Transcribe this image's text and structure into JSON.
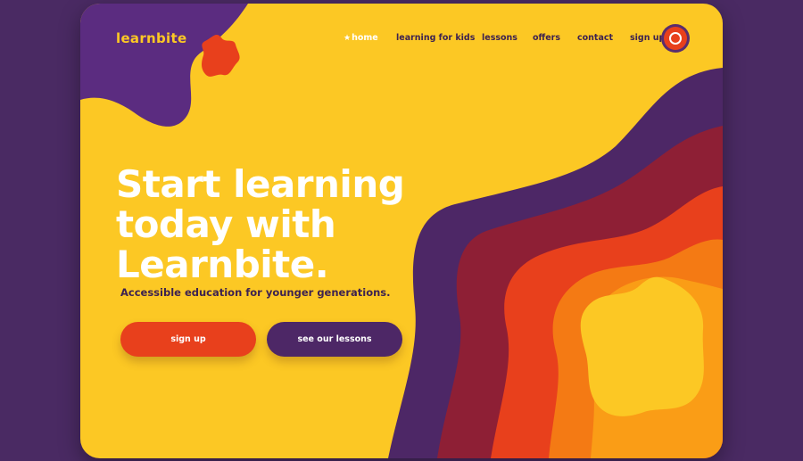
{
  "brand": {
    "logo_text": "learnbite"
  },
  "nav": {
    "home_icon": "star-icon",
    "items": [
      {
        "label": "home",
        "active": true
      },
      {
        "label": "learning for kids",
        "active": false
      },
      {
        "label": "lessons",
        "active": false
      },
      {
        "label": "offers",
        "active": false
      },
      {
        "label": "contact",
        "active": false
      },
      {
        "label": "sign up",
        "active": false
      }
    ]
  },
  "hero": {
    "title": "Start learning today with Learnbite.",
    "subtitle": "Accessible education for younger generations.",
    "primary_button": "sign up",
    "secondary_button": "see our lessons"
  },
  "colors": {
    "page_background": "#4a2a63",
    "yellow": "#fcc824",
    "purple": "#4d2766",
    "dark_red": "#8e1f35",
    "red_orange": "#e8401c",
    "orange": "#f47a14",
    "light_orange": "#fa9d16"
  }
}
